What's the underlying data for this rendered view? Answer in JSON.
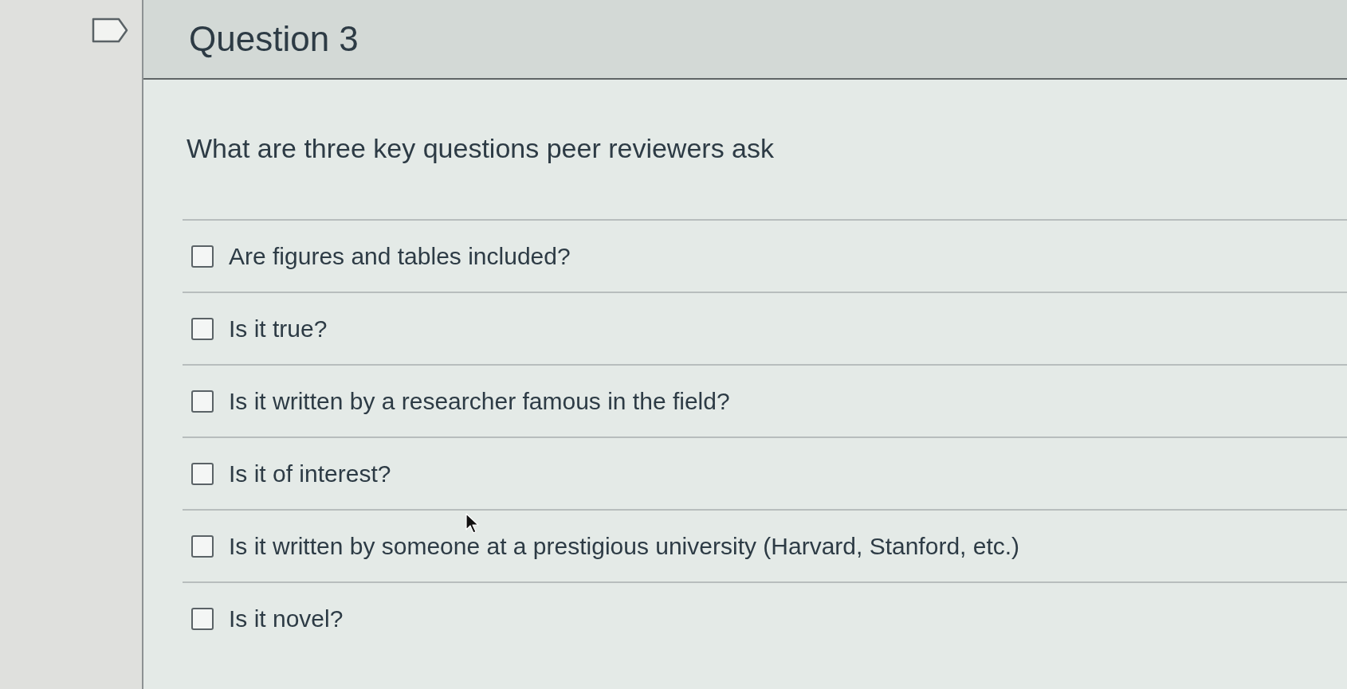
{
  "question": {
    "title": "Question 3",
    "prompt": "What are three key questions peer reviewers ask",
    "options": [
      {
        "label": "Are figures and tables included?",
        "checked": false
      },
      {
        "label": "Is it true?",
        "checked": false
      },
      {
        "label": "Is it written by a researcher famous in the field?",
        "checked": false
      },
      {
        "label": "Is it of interest?",
        "checked": false
      },
      {
        "label": "Is it written by someone at a prestigious university (Harvard, Stanford, etc.)",
        "checked": false
      },
      {
        "label": "Is it novel?",
        "checked": false
      }
    ]
  }
}
